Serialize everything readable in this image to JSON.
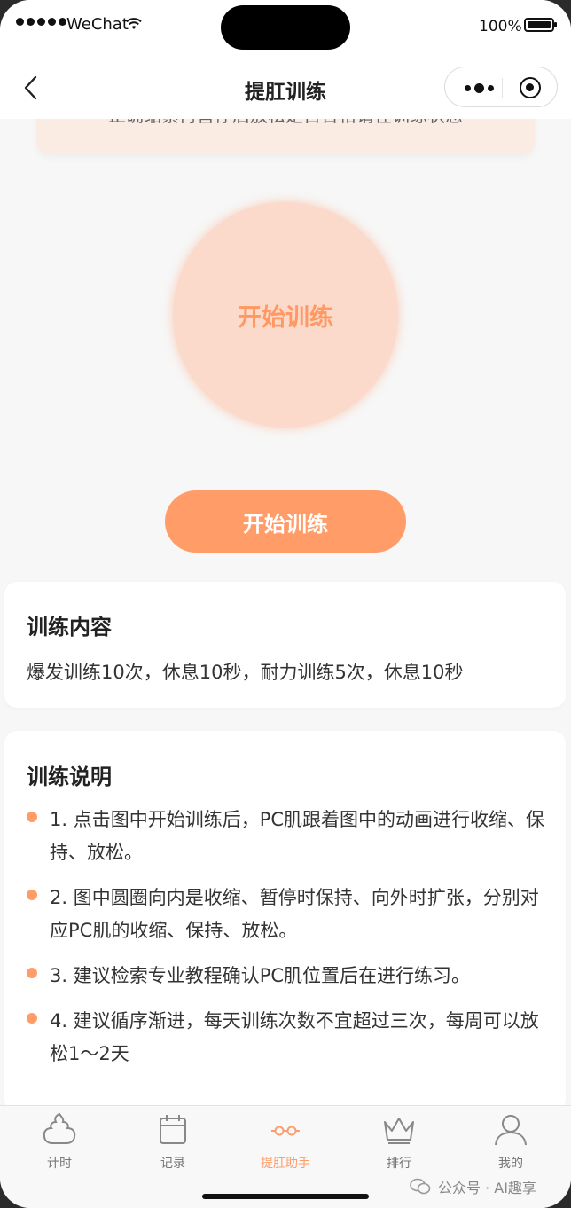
{
  "status_bar": {
    "carrier": "WeChat",
    "battery": "100%"
  },
  "nav": {
    "title": "提肛训练"
  },
  "tip": {
    "text": "正确缩紧再暂停后放松是否合格请在训练状态"
  },
  "circle": {
    "label": "开始训练"
  },
  "start_button": {
    "label": "开始训练"
  },
  "content_card": {
    "title": "训练内容",
    "text": "爆发训练10次，休息10秒，耐力训练5次，休息10秒"
  },
  "desc_card": {
    "title": "训练说明",
    "items": [
      "1. 点击图中开始训练后，PC肌跟着图中的动画进行收缩、保持、放松。",
      "2. 图中圆圈向内是收缩、暂停时保持、向外时扩张，分别对应PC肌的收缩、保持、放松。",
      "3. 建议检索专业教程确认PC肌位置后在进行练习。",
      "4. 建议循序渐进，每天训练次数不宜超过三次，每周可以放松1～2天"
    ]
  },
  "tabs": [
    {
      "label": "计时",
      "icon": "poop-icon",
      "active": false
    },
    {
      "label": "记录",
      "icon": "calendar-icon",
      "active": false
    },
    {
      "label": "提肛助手",
      "icon": "link-icon",
      "active": true
    },
    {
      "label": "排行",
      "icon": "crown-icon",
      "active": false
    },
    {
      "label": "我的",
      "icon": "user-icon",
      "active": false
    }
  ],
  "watermark": {
    "text": "公众号 · AI趣享"
  },
  "colors": {
    "accent": "#ff9c68",
    "circle_bg": "#fbdacb",
    "tip_bg": "#faebe3"
  }
}
